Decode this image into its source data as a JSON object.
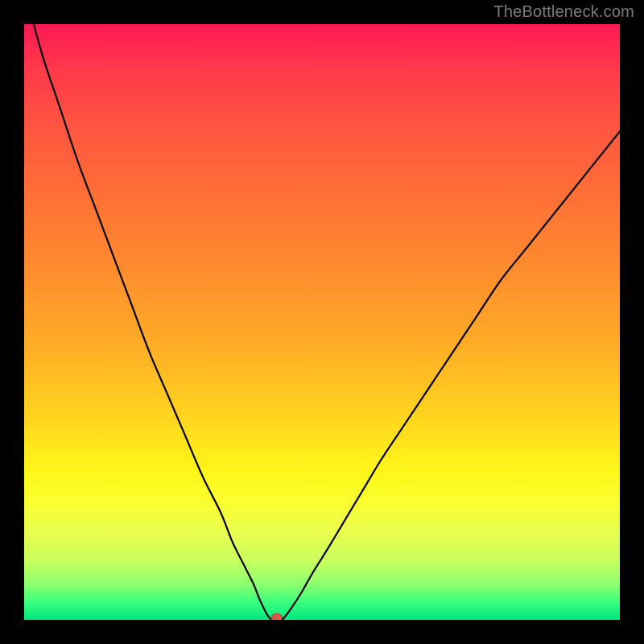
{
  "watermark": "TheBottleneck.com",
  "colors": {
    "frame": "#000000",
    "curve": "#000000",
    "marker_fill": "#d85a4a",
    "marker_stroke": "#b84638",
    "gradient_stops": [
      "#ff1a55",
      "#ff5740",
      "#ff8e2e",
      "#ffd41e",
      "#fff619",
      "#c9ff5e",
      "#00e97f"
    ]
  },
  "chart_data": {
    "type": "line",
    "title": "",
    "xlabel": "",
    "ylabel": "",
    "xlim": [
      0,
      100
    ],
    "ylim": [
      0,
      100
    ],
    "grid": false,
    "curve_left": {
      "x": [
        0.3,
        3,
        6,
        9,
        12,
        15,
        18,
        21,
        24,
        27,
        30,
        33,
        35,
        37,
        38.5,
        39.5,
        40.3,
        40.9,
        41.4
      ],
      "y_pct": [
        105,
        95,
        86,
        77,
        69,
        61,
        53,
        45,
        38,
        31,
        24,
        18,
        13,
        9,
        6,
        3.5,
        1.8,
        0.7,
        0.1
      ]
    },
    "curve_right": {
      "x": [
        43.4,
        44,
        45,
        46.5,
        48.5,
        51,
        54,
        57,
        60,
        64,
        68,
        72,
        76,
        80,
        84,
        88,
        92,
        96,
        100
      ],
      "y_pct": [
        0.1,
        0.8,
        2.2,
        4.5,
        8,
        12,
        17,
        22,
        27,
        33,
        39,
        45,
        51,
        57,
        62,
        67,
        72,
        77,
        82
      ]
    },
    "marker": {
      "x": 42.4,
      "y_pct": 0.0,
      "rx_pct": 0.9,
      "ry_pct": 0.65
    },
    "note": "y_pct is percent of plot height from bottom; x is percent of plot width from left. Background color encodes y (red=high, green=low)."
  }
}
